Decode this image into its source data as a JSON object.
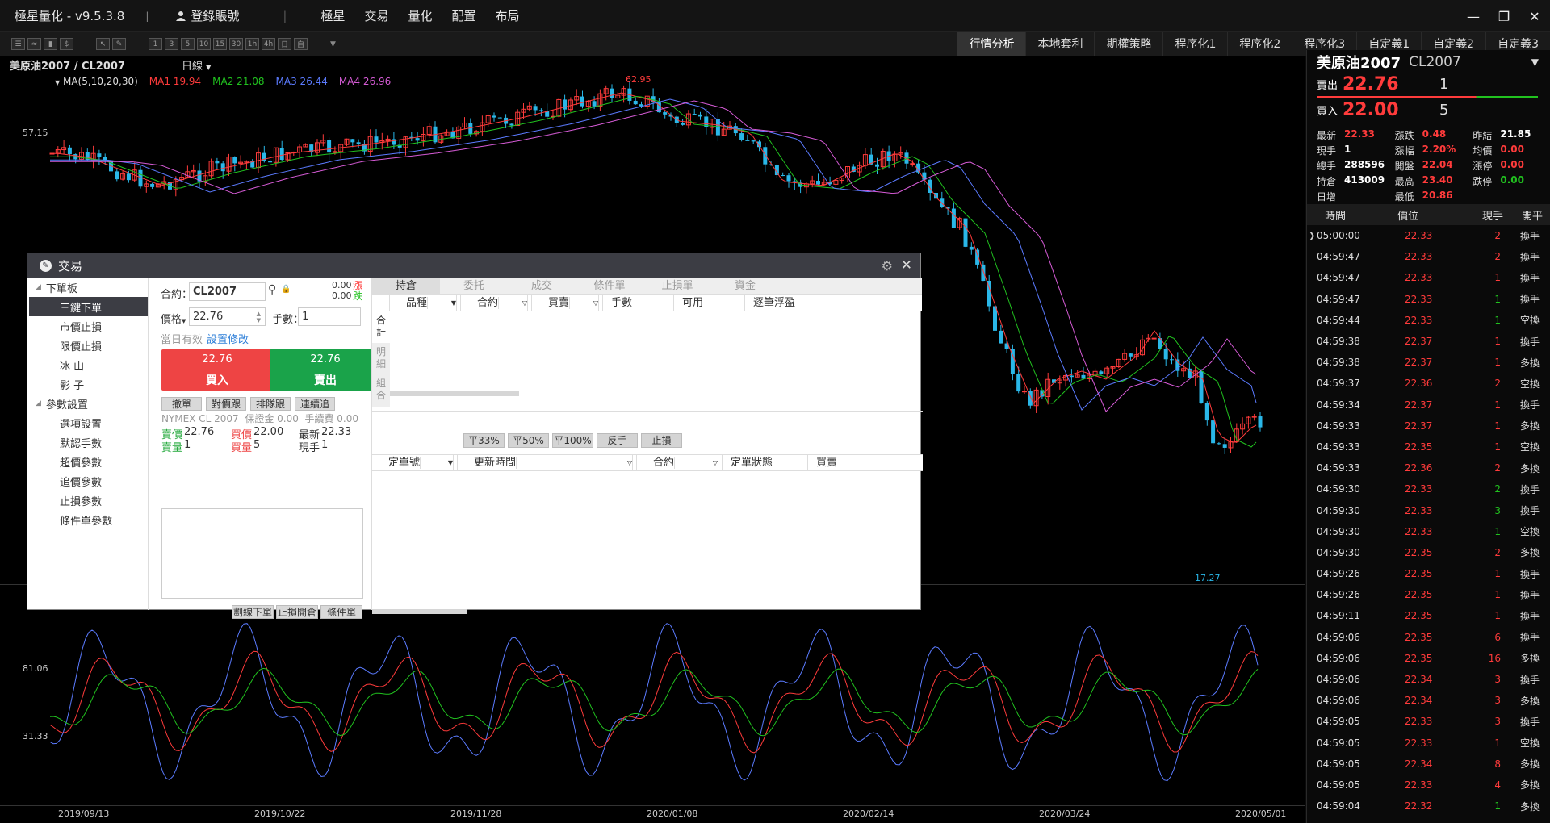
{
  "app": {
    "title": "極星量化 - v9.5.3.8",
    "login": "登錄賬號",
    "menu": [
      "極星",
      "交易",
      "量化",
      "配置",
      "布局"
    ]
  },
  "toolbar": {
    "icons": [
      "list-icon",
      "line-chart-icon",
      "candle-icon",
      "dollar-icon",
      "cursor-icon",
      "pen-icon"
    ],
    "periods": [
      "1",
      "3",
      "5",
      "10",
      "15",
      "30",
      "1h",
      "4h",
      "日",
      "自"
    ],
    "tabs": [
      "行情分析",
      "本地套利",
      "期權策略",
      "程序化1",
      "程序化2",
      "程序化3",
      "自定義1",
      "自定義2",
      "自定義3"
    ],
    "active_tab": "行情分析"
  },
  "chart": {
    "symbol": "美原油2007 / CL2007",
    "period": "日線",
    "ma_label": "MA(5,10,20,30)",
    "ma": [
      {
        "label": "MA1 19.94",
        "color": "#ff3b3b"
      },
      {
        "label": "MA2 21.08",
        "color": "#21c21f"
      },
      {
        "label": "MA3 26.44",
        "color": "#5b7bff"
      },
      {
        "label": "MA4 26.96",
        "color": "#d65bd6"
      }
    ],
    "y_labels": [
      "57.15",
      "81.06",
      "31.33"
    ],
    "high_label": "62.95",
    "low_label": "17.27",
    "x_labels": [
      "2019/09/13",
      "2019/10/22",
      "2019/11/28",
      "2020/01/08",
      "2020/02/14",
      "2020/03/24",
      "2020/05/01"
    ],
    "colors": {
      "up": "#ff3b3b",
      "down": "#2ab7e8",
      "ma1": "#ff3b3b",
      "ma2": "#21c21f",
      "ma3": "#5b7bff",
      "ma4": "#d65bd6"
    }
  },
  "quote": {
    "name": "美原油2007",
    "code": "CL2007",
    "ask_label": "賣出",
    "ask_price": "22.76",
    "ask_vol": "1",
    "bid_label": "買入",
    "bid_price": "22.00",
    "bid_vol": "5",
    "fields": [
      [
        {
          "k": "最新",
          "v": "22.33",
          "c": "red"
        },
        {
          "k": "漲跌",
          "v": "0.48",
          "c": "red"
        },
        {
          "k": "昨結",
          "v": "21.85",
          "c": "white"
        }
      ],
      [
        {
          "k": "現手",
          "v": "1",
          "c": "white"
        },
        {
          "k": "漲幅",
          "v": "2.20%",
          "c": "red"
        },
        {
          "k": "均價",
          "v": "0.00",
          "c": "red"
        }
      ],
      [
        {
          "k": "總手",
          "v": "288596",
          "c": "white"
        },
        {
          "k": "開盤",
          "v": "22.04",
          "c": "red"
        },
        {
          "k": "漲停",
          "v": "0.00",
          "c": "red"
        }
      ],
      [
        {
          "k": "持倉",
          "v": "413009",
          "c": "white"
        },
        {
          "k": "最高",
          "v": "23.40",
          "c": "red"
        },
        {
          "k": "跌停",
          "v": "0.00",
          "c": "green"
        }
      ],
      [
        {
          "k": "日增",
          "v": "",
          "c": "white"
        },
        {
          "k": "最低",
          "v": "20.86",
          "c": "red"
        },
        {
          "k": "",
          "v": "",
          "c": "white"
        }
      ]
    ],
    "tick_headers": [
      "時間",
      "價位",
      "現手",
      "開平"
    ],
    "ticks": [
      [
        "05:00:00",
        "22.33",
        "2",
        "換手",
        "red"
      ],
      [
        "04:59:47",
        "22.33",
        "2",
        "換手",
        "red"
      ],
      [
        "04:59:47",
        "22.33",
        "1",
        "換手",
        "red"
      ],
      [
        "04:59:47",
        "22.33",
        "1",
        "換手",
        "green"
      ],
      [
        "04:59:44",
        "22.33",
        "1",
        "空換",
        "green"
      ],
      [
        "04:59:38",
        "22.37",
        "1",
        "換手",
        "red"
      ],
      [
        "04:59:38",
        "22.37",
        "1",
        "多換",
        "red"
      ],
      [
        "04:59:37",
        "22.36",
        "2",
        "空換",
        "red"
      ],
      [
        "04:59:34",
        "22.37",
        "1",
        "換手",
        "red"
      ],
      [
        "04:59:33",
        "22.37",
        "1",
        "多換",
        "red"
      ],
      [
        "04:59:33",
        "22.35",
        "1",
        "空換",
        "red"
      ],
      [
        "04:59:33",
        "22.36",
        "2",
        "多換",
        "red"
      ],
      [
        "04:59:30",
        "22.33",
        "2",
        "換手",
        "green"
      ],
      [
        "04:59:30",
        "22.33",
        "3",
        "換手",
        "green"
      ],
      [
        "04:59:30",
        "22.33",
        "1",
        "空換",
        "green"
      ],
      [
        "04:59:30",
        "22.35",
        "2",
        "多換",
        "red"
      ],
      [
        "04:59:26",
        "22.35",
        "1",
        "換手",
        "red"
      ],
      [
        "04:59:26",
        "22.35",
        "1",
        "換手",
        "red"
      ],
      [
        "04:59:11",
        "22.35",
        "1",
        "換手",
        "red"
      ],
      [
        "04:59:06",
        "22.35",
        "6",
        "換手",
        "red"
      ],
      [
        "04:59:06",
        "22.35",
        "16",
        "多換",
        "red"
      ],
      [
        "04:59:06",
        "22.34",
        "3",
        "換手",
        "red"
      ],
      [
        "04:59:06",
        "22.34",
        "3",
        "多換",
        "red"
      ],
      [
        "04:59:05",
        "22.33",
        "3",
        "換手",
        "red"
      ],
      [
        "04:59:05",
        "22.33",
        "1",
        "空換",
        "red"
      ],
      [
        "04:59:05",
        "22.34",
        "8",
        "多換",
        "red"
      ],
      [
        "04:59:05",
        "22.33",
        "4",
        "多換",
        "red"
      ],
      [
        "04:59:04",
        "22.32",
        "1",
        "多換",
        "green"
      ]
    ]
  },
  "trade": {
    "title": "交易",
    "tree": [
      {
        "label": "下單板",
        "level": 0
      },
      {
        "label": "三鍵下單",
        "level": 1,
        "selected": true
      },
      {
        "label": "市價止損",
        "level": 1
      },
      {
        "label": "限價止損",
        "level": 1
      },
      {
        "label": "冰 山",
        "level": 1
      },
      {
        "label": "影 子",
        "level": 1
      },
      {
        "label": "參數設置",
        "level": 0
      },
      {
        "label": "選項設置",
        "level": 1
      },
      {
        "label": "默認手數",
        "level": 1
      },
      {
        "label": "超價參數",
        "level": 1
      },
      {
        "label": "追價參數",
        "level": 1
      },
      {
        "label": "止損參數",
        "level": 1
      },
      {
        "label": "條件單參數",
        "level": 1
      }
    ],
    "contract_label": "合約：",
    "contract_value": "CL2007",
    "limit_up": "0.00",
    "limit_up_label": "漲",
    "limit_down": "0.00",
    "limit_down_label": "跌",
    "price_label": "價格",
    "price_value": "22.76",
    "qty_label": "手數：",
    "qty_value": "1",
    "valid_text": "當日有效",
    "settings_link": "設置修改",
    "buy_price": "22.76",
    "buy_label": "買入",
    "sell_price": "22.76",
    "sell_label": "賣出",
    "small_buttons": [
      "撤單",
      "對價跟",
      "排隊跟",
      "連續追"
    ],
    "info_line": "NYMEX CL 2007  保證金 0.00  手續費 0.00",
    "ask_label": "賣價",
    "ask_value": "22.76",
    "bid_label": "買價",
    "bid_value": "22.00",
    "last_label": "最新",
    "last_value": "22.33",
    "ask_vol_label": "賣量",
    "ask_vol_value": "1",
    "bid_vol_label": "買量",
    "bid_vol_value": "5",
    "cur_vol_label": "現手",
    "cur_vol_value": "1",
    "bottom_buttons": [
      "劃線下單",
      "止損開倉",
      "條件單"
    ],
    "pos_tabs": [
      "持倉",
      "委托",
      "成交",
      "條件單",
      "止損單",
      "資金"
    ],
    "pos_cols": [
      "品種",
      "合約",
      "買賣",
      "手數",
      "可用",
      "逐筆浮盈"
    ],
    "side_tabs": [
      "合計",
      "明細",
      "組合"
    ],
    "close_buttons": [
      "平33%",
      "平50%",
      "平100%",
      "反手",
      "止損"
    ],
    "order_cols": [
      "定單號",
      "更新時間",
      "合約",
      "定單狀態",
      "買賣"
    ]
  }
}
